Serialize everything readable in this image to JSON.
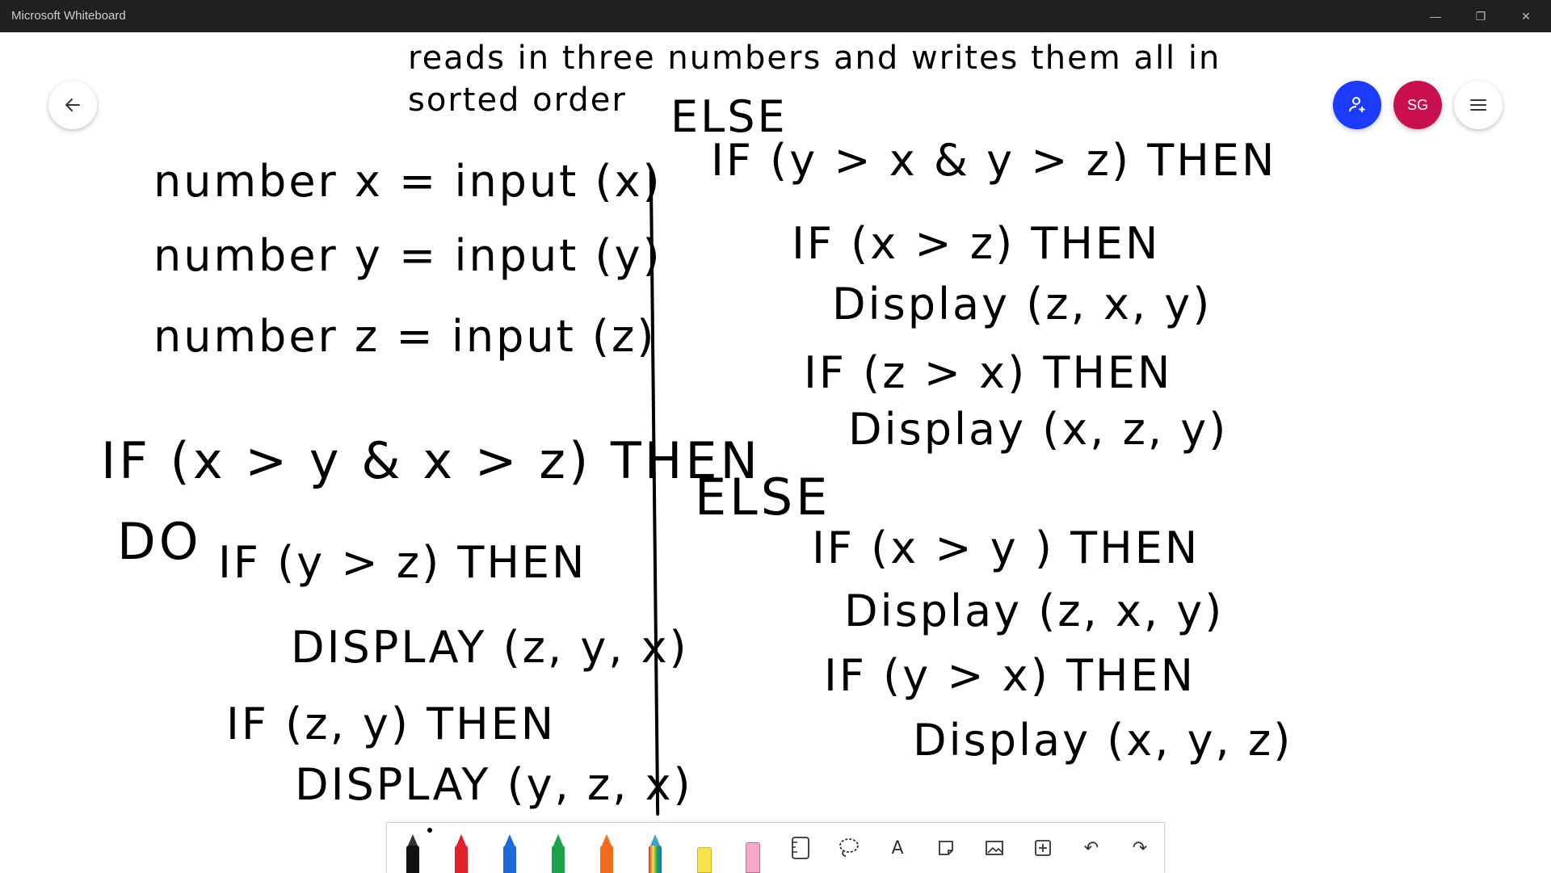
{
  "window": {
    "title": "Microsoft Whiteboard",
    "minimize_glyph": "—",
    "restore_glyph": "❐",
    "close_glyph": "✕"
  },
  "header": {
    "avatar_initials": "SG"
  },
  "colors": {
    "titlebar": "#202020",
    "share_button": "#1b3bff",
    "avatar": "#c8104f"
  },
  "board": {
    "prompt_line1": "reads in three numbers and writes them all in",
    "prompt_line2": "sorted order",
    "left": [
      "number x = input (x)",
      "number y =  input (y)",
      "number z = input (z)",
      "IF (x > y & x > z) THEN",
      "DO",
      "IF (y > z)  THEN",
      "DISPLAY (z, y, x)",
      "IF (z, y) THEN",
      "DISPLAY (y, z, x)"
    ],
    "right": [
      "ELSE",
      "IF (y > x & y > z) THEN",
      "IF (x > z) THEN",
      "Display (z, x, y)",
      "IF (z > x) THEN",
      "Display (x, z, y)",
      "ELSE",
      "IF (x > y ) THEN",
      "Display (z, x, y)",
      "IF (y > x) THEN",
      "Display (x, y, z)"
    ]
  },
  "toolbar": {
    "tools": [
      {
        "name": "black-pen",
        "color": "#111111"
      },
      {
        "name": "red-pen",
        "color": "#e0202a"
      },
      {
        "name": "blue-pen",
        "color": "#1c6ad8"
      },
      {
        "name": "green-pen",
        "color": "#1aa34a"
      },
      {
        "name": "orange-pen",
        "color": "#f36b1c"
      },
      {
        "name": "rainbow-pen",
        "color": "#3aa6c8"
      },
      {
        "name": "highlighter",
        "color": "#f7e24b"
      },
      {
        "name": "eraser",
        "color": "#f4a9c8"
      },
      {
        "name": "ruler-icon"
      },
      {
        "name": "lasso-icon"
      },
      {
        "name": "text-icon",
        "glyph": "A"
      },
      {
        "name": "note-icon"
      },
      {
        "name": "image-icon"
      },
      {
        "name": "insert-icon"
      },
      {
        "name": "undo-icon",
        "glyph": "↶"
      },
      {
        "name": "redo-icon",
        "glyph": "↷"
      }
    ]
  }
}
